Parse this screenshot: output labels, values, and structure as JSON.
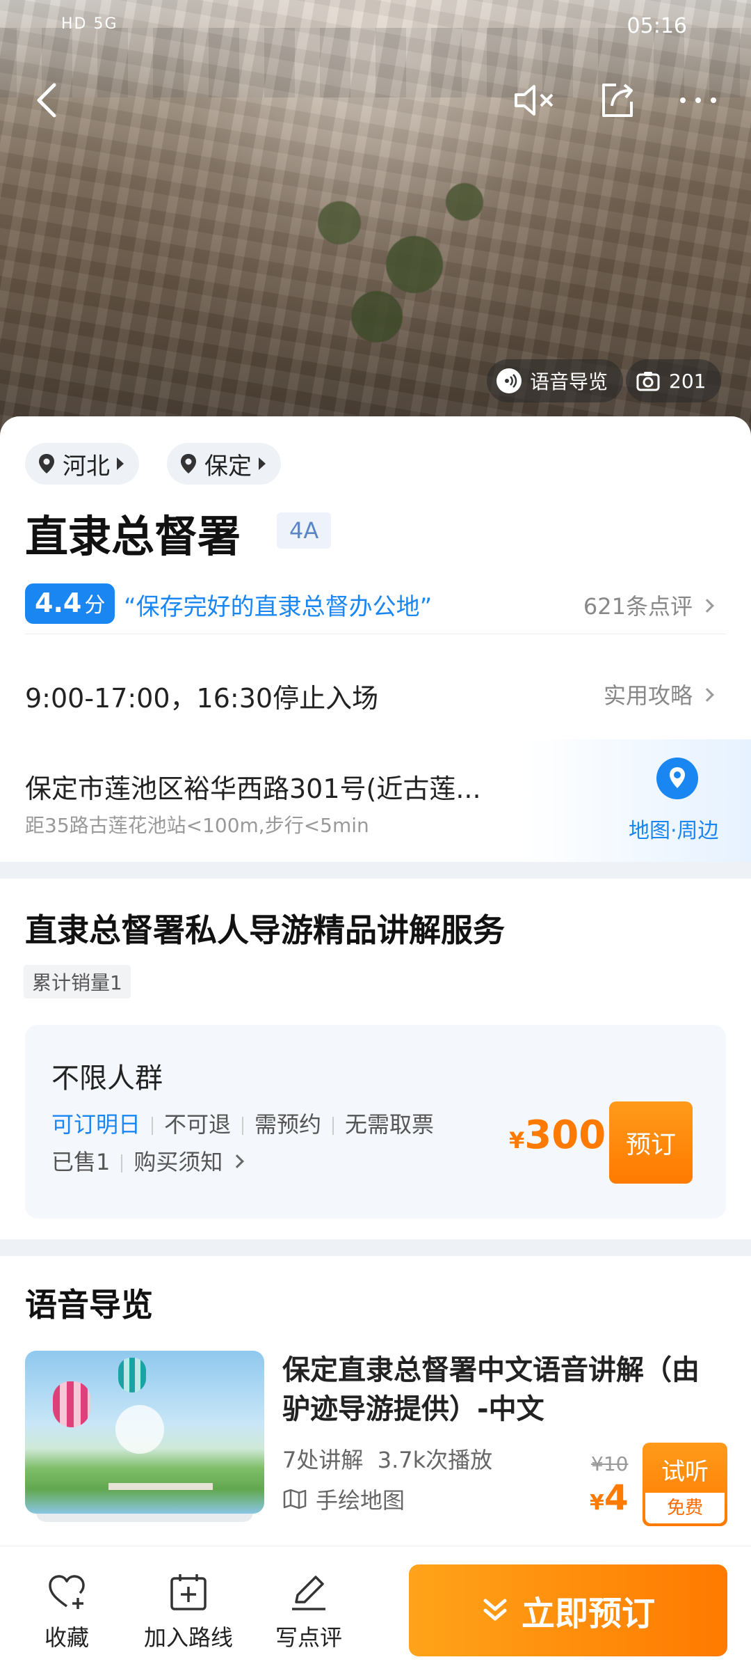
{
  "status_bar": {
    "left": "HD 5G",
    "time": "05:16"
  },
  "hero": {
    "audio_label": "语音导览",
    "photo_count": "201"
  },
  "location": {
    "province": "河北",
    "city": "保定"
  },
  "attraction": {
    "name": "直隶总督署",
    "level": "4A",
    "score": "4.4",
    "score_unit": "分",
    "quote": "“保存完好的直隶总督办公地”",
    "reviews": "621条点评",
    "hours": "9:00-17:00，16:30停止入场",
    "guide_link": "实用攻略",
    "address": "保定市莲池区裕华西路301号(近古莲...",
    "distance": "距35路古莲花池站<100m,步行<5min",
    "map_link": "地图·周边"
  },
  "service": {
    "title": "直隶总督署私人导游精品讲解服务",
    "sales": "累计销量1",
    "package_name": "不限人群",
    "tag_available": "可订明日",
    "tag_refund": "不可退",
    "tag_reserve": "需预约",
    "tag_ticket": "无需取票",
    "sold": "已售1",
    "notice": "购买须知",
    "currency": "¥",
    "price": "300",
    "book_label": "预订"
  },
  "audio_guide": {
    "section_title": "语音导览",
    "item_title": "保定直隶总督署中文语音讲解（由驴迹导游提供）-中文",
    "points": "7处讲解",
    "plays": "3.7k次播放",
    "map_label": "手绘地图",
    "old_price": "¥10",
    "currency": "¥",
    "price": "4",
    "try_label": "试听",
    "free_label": "免费"
  },
  "bottom_bar": {
    "favorite": "收藏",
    "add_route": "加入路线",
    "write_review": "写点评",
    "book_now": "立即预订"
  },
  "colors": {
    "accent_blue": "#1a86f2",
    "accent_orange": "#ff7a00"
  }
}
